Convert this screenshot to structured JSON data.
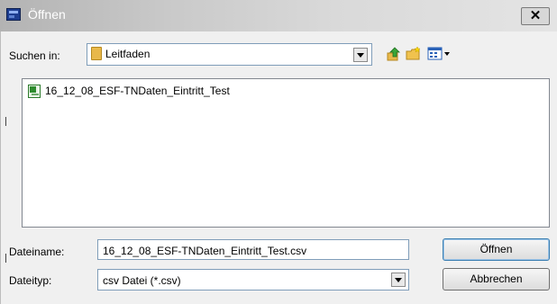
{
  "window": {
    "title": "Öffnen",
    "close_glyph": "✕"
  },
  "lookin": {
    "label": "Suchen in:",
    "folder": "Leitfaden",
    "folder_icon": "folder-icon"
  },
  "toolbar": {
    "icons": [
      "up-folder-icon",
      "new-folder-icon",
      "view-menu-icon"
    ]
  },
  "files": [
    {
      "name": "16_12_08_ESF-TNDaten_Eintritt_Test",
      "icon": "excel-file-icon"
    }
  ],
  "filename": {
    "label": "Dateiname:",
    "value": "16_12_08_ESF-TNDaten_Eintritt_Test.csv"
  },
  "filetype": {
    "label": "Dateityp:",
    "value": "csv Datei (*.csv)"
  },
  "buttons": {
    "open": "Öffnen",
    "cancel": "Abbrechen"
  },
  "colors": {
    "title_bar": "#c9c9c9",
    "dialog_bg": "#f0f0f0",
    "accent": "#3c7fb1"
  }
}
